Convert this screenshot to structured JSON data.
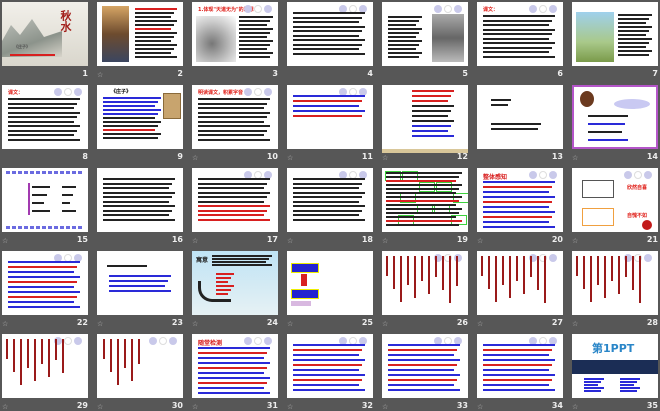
{
  "view": "slide-sorter",
  "animation_icon": "star-icon",
  "slides": [
    {
      "number": "1",
      "title": "秋水",
      "subtitle": "《庄子》",
      "animated": false
    },
    {
      "number": "2",
      "title": "",
      "animated": true
    },
    {
      "number": "3",
      "title": "1.体现\"天道无为\"的思想",
      "animated": false
    },
    {
      "number": "4",
      "title": "",
      "animated": false
    },
    {
      "number": "5",
      "title": "",
      "animated": false
    },
    {
      "number": "6",
      "title": "课文：",
      "animated": false
    },
    {
      "number": "7",
      "title": "",
      "animated": false
    },
    {
      "number": "8",
      "title": "课文：",
      "animated": false
    },
    {
      "number": "9",
      "title": "《庄子》",
      "animated": false
    },
    {
      "number": "10",
      "title": "明读课文，积累字音",
      "animated": true
    },
    {
      "number": "11",
      "title": "",
      "animated": true
    },
    {
      "number": "12",
      "title": "",
      "animated": true
    },
    {
      "number": "13",
      "title": "",
      "animated": false
    },
    {
      "number": "14",
      "title": "",
      "animated": true
    },
    {
      "number": "15",
      "title": "",
      "animated": true
    },
    {
      "number": "16",
      "title": "",
      "animated": false
    },
    {
      "number": "17",
      "title": "",
      "animated": true
    },
    {
      "number": "18",
      "title": "",
      "animated": true
    },
    {
      "number": "19",
      "title": "",
      "animated": true
    },
    {
      "number": "20",
      "title": "整体感知",
      "animated": true
    },
    {
      "number": "21",
      "title": "",
      "labels": [
        "欣然自喜",
        "自愧不如"
      ],
      "animated": true
    },
    {
      "number": "22",
      "title": "",
      "animated": true
    },
    {
      "number": "23",
      "title": "",
      "animated": true
    },
    {
      "number": "24",
      "title": "寓意",
      "animated": true
    },
    {
      "number": "25",
      "title": "",
      "animated": true
    },
    {
      "number": "26",
      "title": "",
      "animated": true
    },
    {
      "number": "27",
      "title": "",
      "animated": true
    },
    {
      "number": "28",
      "title": "",
      "animated": true
    },
    {
      "number": "29",
      "title": "",
      "animated": true
    },
    {
      "number": "30",
      "title": "",
      "animated": true
    },
    {
      "number": "31",
      "title": "随堂检测",
      "animated": true
    },
    {
      "number": "32",
      "title": "",
      "animated": true
    },
    {
      "number": "33",
      "title": "",
      "animated": true
    },
    {
      "number": "34",
      "title": "",
      "animated": true
    },
    {
      "number": "35",
      "title": "第1PPT",
      "animated": true
    }
  ]
}
